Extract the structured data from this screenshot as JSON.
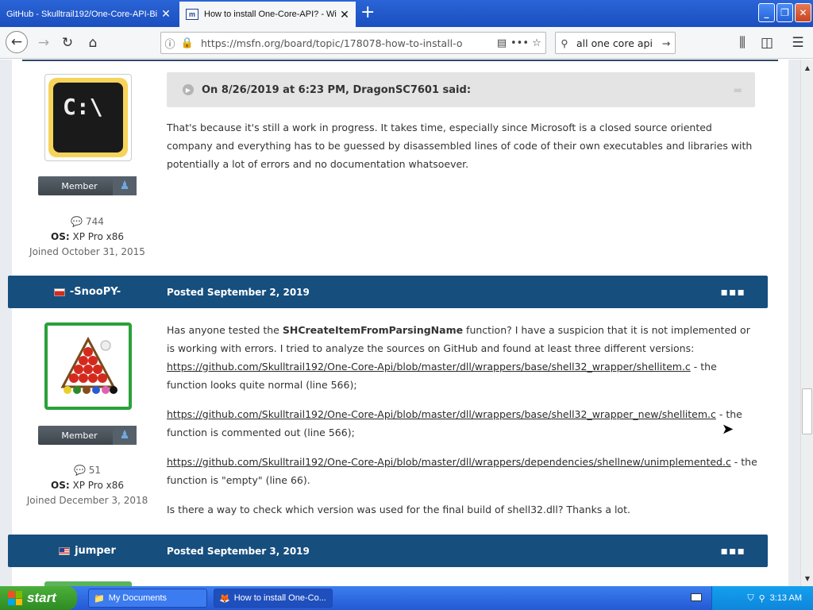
{
  "browser": {
    "tabs": [
      {
        "title": "GitHub - Skulltrail192/One-Core-API-Bi",
        "active": false
      },
      {
        "title": "How to install One-Core-API? - Wi",
        "active": true
      }
    ],
    "url": "https://msfn.org/board/topic/178078-how-to-install-o",
    "search_value": "all one core api"
  },
  "post1": {
    "avatar_text": "C:\\",
    "rank": "Member",
    "post_count": "744",
    "os_label": "OS:",
    "os_value": "XP Pro x86",
    "joined": "Joined October 31, 2015",
    "quote_header": "On 8/26/2019 at 6:23 PM, DragonSC7601 said:",
    "body": "That's because it's still a work in progress. It takes time, especially since Microsoft is a closed source oriented company and everything has to be guessed by disassembled lines of code of their own executables and libraries with potentially a lot of errors and no documentation whatsoever."
  },
  "post2": {
    "author": "-SnooPY-",
    "posted": "Posted September 2, 2019",
    "rank": "Member",
    "post_count": "51",
    "os_label": "OS:",
    "os_value": "XP Pro x86",
    "joined": "Joined December 3, 2018",
    "intro_before": "Has anyone tested the ",
    "intro_bold": "SHCreateItemFromParsingName",
    "intro_after": " function? I have a suspicion that it is not implemented or is working with errors. I tried to analyze the sources on GitHub and found at least three different versions:",
    "link1": "https://github.com/Skulltrail192/One-Core-Api/blob/master/dll/wrappers/base/shell32_wrapper/shellitem.c",
    "link1_after": "  - the function looks quite normal (line 566);",
    "link2": "https://github.com/Skulltrail192/One-Core-Api/blob/master/dll/wrappers/base/shell32_wrapper_new/shellitem.c",
    "link2_after": "  - the function is commented out (line 566);",
    "link3": "https://github.com/Skulltrail192/One-Core-Api/blob/master/dll/wrappers/dependencies/shellnew/unimplemented.c",
    "link3_after": "  - the function is \"empty\" (line 66).",
    "closing": "Is there a way to check which version was used for the final build of shell32.dll? Thanks a lot."
  },
  "post3": {
    "author": "jumper",
    "posted": "Posted September 3, 2019"
  },
  "taskbar": {
    "start": "start",
    "tasks": [
      "My Documents",
      "How to install One-Co..."
    ],
    "clock": "3:13 AM"
  }
}
